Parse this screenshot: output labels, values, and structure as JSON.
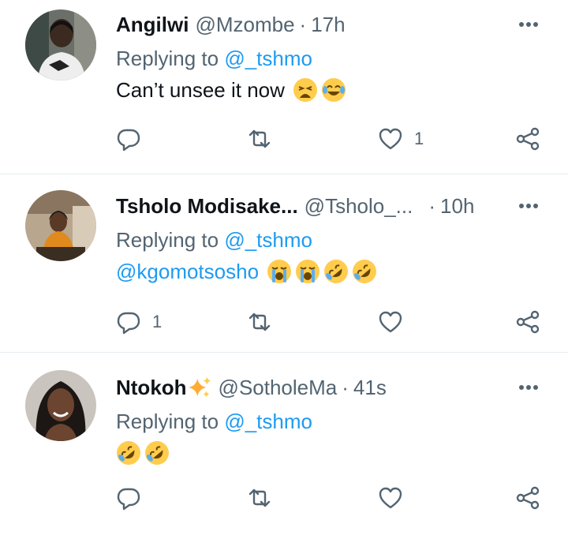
{
  "tweets": [
    {
      "name": "Angilwi",
      "handle": "@Mzombe",
      "separator": "·",
      "time": "17h",
      "reply_prefix": "Replying to",
      "reply_to": "@_tshmo",
      "text": "Can’t unsee it now",
      "mention": "",
      "emojis": [
        "weary-face",
        "face-with-tears-of-joy"
      ],
      "reply_count": "",
      "like_count": "1"
    },
    {
      "name": "Tsholo Modisake...",
      "handle": "@Tsholo_...",
      "separator": "·",
      "time": "10h",
      "reply_prefix": "Replying to",
      "reply_to": "@_tshmo",
      "text": "",
      "mention": "@kgomotsosho",
      "emojis": [
        "loudly-crying-face",
        "loudly-crying-face",
        "rolling-on-floor-laughing",
        "rolling-on-floor-laughing"
      ],
      "reply_count": "1",
      "like_count": ""
    },
    {
      "name": "Ntokoh",
      "handle": "@SotholeMa",
      "separator": "·",
      "time": "41s",
      "reply_prefix": "Replying to",
      "reply_to": "@_tshmo",
      "text": "",
      "mention": "",
      "emojis": [
        "rolling-on-floor-laughing",
        "rolling-on-floor-laughing"
      ],
      "reply_count": "",
      "like_count": ""
    }
  ],
  "colors": {
    "text": "#0f1419",
    "secondary": "#536471",
    "link": "#1d9bf0",
    "divider": "#e6ecf0",
    "emoji_yellow": "#ffcc4d"
  },
  "icons": {
    "more": "ellipsis-icon",
    "reply": "reply-icon",
    "retweet": "retweet-icon",
    "like": "heart-icon",
    "share": "share-icon",
    "sparkles": "sparkles-icon"
  }
}
